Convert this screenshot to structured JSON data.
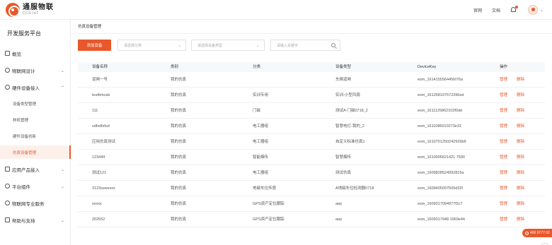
{
  "header": {
    "logo_cn": "通服物联",
    "logo_en": "CCS IoT",
    "links": [
      "官网",
      "文档"
    ],
    "brand_color": "#e8582a"
  },
  "sidebar": {
    "title": "开发服务平台",
    "items": [
      {
        "label": "概览",
        "icon": "overview-icon",
        "chevron": ""
      },
      {
        "label": "物联网设计",
        "icon": "design-icon",
        "chevron": "⌄"
      },
      {
        "label": "硬件设备接入",
        "icon": "hardware-icon",
        "chevron": "⌃"
      },
      {
        "label": "应用产品接入",
        "icon": "app-icon",
        "chevron": "⌄"
      },
      {
        "label": "平台组件",
        "icon": "component-icon",
        "chevron": "⌄"
      },
      {
        "label": "物联网专业服务",
        "icon": "service-icon",
        "chevron": ""
      },
      {
        "label": "帮助与支持",
        "icon": "help-icon",
        "chevron": "⌄"
      }
    ],
    "subitems": [
      {
        "label": "设备类型管理"
      },
      {
        "label": "样机管理"
      },
      {
        "label": "硬件设备创新"
      },
      {
        "label": "仿真设备管理"
      }
    ]
  },
  "content": {
    "breadcrumb": "仿真设备管理",
    "add_button": "添加设备",
    "filter1_placeholder": "请选择分类",
    "filter2_placeholder": "请选择设备类型",
    "search_placeholder": "请输入关键字",
    "columns": [
      "设备名称",
      "类别",
      "分类",
      "设备类型",
      "DeviceKey",
      "操作"
    ],
    "rows": [
      {
        "name": "道闸一号",
        "category": "我的仿真",
        "class": "",
        "type": "车辆道闸",
        "key": "esm_1614155564456f76a"
      },
      {
        "name": "testfehcab",
        "category": "我的仿真",
        "class": "实训专用",
        "type": "实训-小型风扇",
        "key": "esm_161268107572396ed"
      },
      {
        "name": "111",
        "category": "我的仿真",
        "class": "门磁",
        "type": "测试A-门磁0718_2",
        "key": "esm_1611125862102f0dd"
      },
      {
        "name": "sdfsdfsfsd",
        "category": "我的仿真",
        "class": "电工器组",
        "type": "智慧电灯-我的_2",
        "key": "esm_1611086010273e31"
      },
      {
        "name": "应用仿真测试",
        "category": "我的仿真",
        "class": "电工器组",
        "type": "自定义标准仿真1",
        "key": "esm_1610701250242926b8"
      },
      {
        "name": "123444",
        "category": "我的仿真",
        "class": "智能烟传",
        "type": "智慧烟传",
        "key": "esm_1610005621421 7690"
      },
      {
        "name": "测试121",
        "category": "我的仿真",
        "class": "电工器组",
        "type": "测试仿真",
        "key": "esm_1609828524992815a"
      },
      {
        "name": "3123sswxxxx",
        "category": "我的仿真",
        "class": "地磁车位传感",
        "type": "A地磁车位检测器0718",
        "key": "esm_1609405097500d32f"
      },
      {
        "name": "xxxxx",
        "category": "我的仿真",
        "class": "GPS资产定位跟踪",
        "type": "aep",
        "key": "esm_1609317094977f2c7"
      },
      {
        "name": "202552",
        "category": "我的仿真",
        "class": "GPS资产定位跟踪",
        "type": "aep",
        "key": "esm_1609317948 1969e44"
      }
    ],
    "action_edit": "管理",
    "action_delete": "删除"
  },
  "floating": {
    "phone": "400 0777 02",
    "back_top": "↑"
  }
}
